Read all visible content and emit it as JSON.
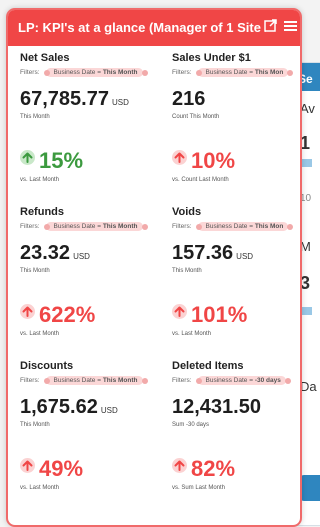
{
  "card": {
    "title": "LP: KPI's at a glance (Manager of 1 Site ...",
    "expand_icon": "expand-icon",
    "menu_icon": "hamburger-menu-icon",
    "header_color": "#f04646"
  },
  "kpis": [
    {
      "title": "Net Sales",
      "filter_label": "Filters:",
      "filter_key": "Business Date = ",
      "filter_value": "This Month",
      "value": "67,785.77",
      "unit": "USD",
      "sub": "This Month",
      "change": "15%",
      "direction": "up",
      "vs": "vs. Last Month"
    },
    {
      "title": "Sales Under $1",
      "filter_label": "Filters:",
      "filter_key": "Business Date = ",
      "filter_value": "This Mon",
      "value": "216",
      "unit": "",
      "sub": "Count This Month",
      "change": "10%",
      "direction": "up-bad",
      "vs": "vs. Count Last Month"
    },
    {
      "title": "Refunds",
      "filter_label": "Filters:",
      "filter_key": "Business Date = ",
      "filter_value": "This Month",
      "value": "23.32",
      "unit": "USD",
      "sub": "This Month",
      "change": "622%",
      "direction": "up-bad",
      "vs": "vs. Last Month"
    },
    {
      "title": "Voids",
      "filter_label": "Filters:",
      "filter_key": "Business Date = ",
      "filter_value": "This Mon",
      "value": "157.36",
      "unit": "USD",
      "sub": "This Month",
      "change": "101%",
      "direction": "up-bad",
      "vs": "vs. Last Month"
    },
    {
      "title": "Discounts",
      "filter_label": "Filters:",
      "filter_key": "Business Date = ",
      "filter_value": "This Month",
      "value": "1,675.62",
      "unit": "USD",
      "sub": "This Month",
      "change": "49%",
      "direction": "up-bad",
      "vs": "vs. Last Month"
    },
    {
      "title": "Deleted Items",
      "filter_label": "Filters:",
      "filter_key": "Business Date = ",
      "filter_value": "-30 days",
      "value": "12,431.50",
      "unit": "",
      "sub": "Sum -30 days",
      "change": "82%",
      "direction": "up-bad",
      "vs": "vs. Sum Last Month"
    }
  ],
  "side_card": {
    "header": "Se",
    "fragments": [
      "Av",
      "1",
      "10",
      "M",
      "3",
      "Da"
    ]
  },
  "colors": {
    "positive": "#3c9a3f",
    "negative": "#f04646",
    "side_header": "#2f86bf"
  }
}
